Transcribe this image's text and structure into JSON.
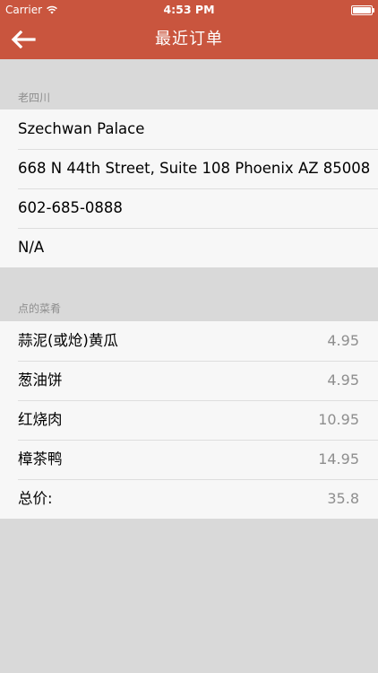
{
  "status_bar": {
    "carrier": "Carrier",
    "time": "4:53 PM"
  },
  "nav": {
    "title": "最近订单",
    "back_icon": "arrow-left-icon"
  },
  "restaurant_section": {
    "header": "老四川",
    "rows": [
      {
        "text": "Szechwan Palace"
      },
      {
        "text": "668 N 44th Street, Suite 108 Phoenix AZ 85008"
      },
      {
        "text": "602-685-0888"
      },
      {
        "text": "N/A"
      }
    ]
  },
  "dishes_section": {
    "header": "点的菜肴",
    "rows": [
      {
        "name": "蒜泥(或炝)黄瓜",
        "price": "4.95"
      },
      {
        "name": "葱油饼",
        "price": "4.95"
      },
      {
        "name": "红烧肉",
        "price": "10.95"
      },
      {
        "name": "樟茶鸭",
        "price": "14.95"
      }
    ],
    "total_label": "总价:",
    "total_value": "35.8"
  },
  "colors": {
    "accent": "#c9553e",
    "background": "#d9d9d9",
    "cell": "#f7f7f7",
    "secondary_text": "#8e8e8e"
  }
}
